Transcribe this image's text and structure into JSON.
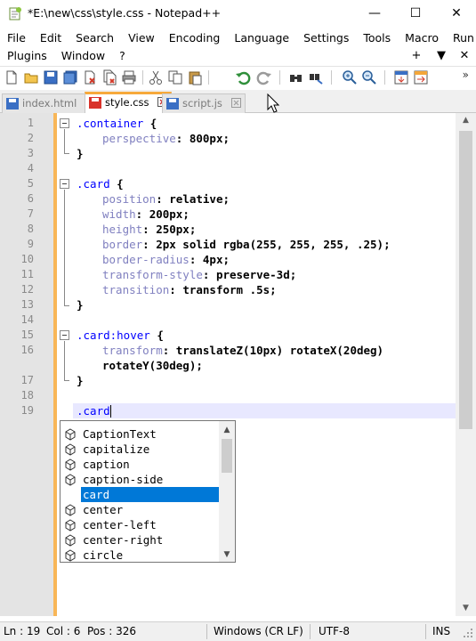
{
  "window": {
    "title": "*E:\\new\\css\\style.css - Notepad++",
    "minimize_glyph": "—",
    "maximize_glyph": "☐",
    "close_glyph": "✕"
  },
  "menu": {
    "row1": [
      "File",
      "Edit",
      "Search",
      "View",
      "Encoding",
      "Language",
      "Settings",
      "Tools",
      "Macro",
      "Run"
    ],
    "row2": [
      "Plugins",
      "Window",
      "?"
    ],
    "doc_controls": [
      "+",
      "▼",
      "✕"
    ]
  },
  "toolbar": {
    "icons": [
      "new-file-icon",
      "open-file-icon",
      "save-icon",
      "save-all-icon",
      "close-icon",
      "close-all-icon",
      "print-icon",
      "cut-icon",
      "copy-icon",
      "paste-icon",
      "undo-icon",
      "redo-icon",
      "find-icon",
      "replace-icon",
      "zoom-in-icon",
      "zoom-out-icon",
      "sync-vertical-icon",
      "sync-horizontal-icon"
    ],
    "more_glyph": "»"
  },
  "tabs": [
    {
      "label": "index.html",
      "active": false
    },
    {
      "label": "style.css",
      "active": true
    },
    {
      "label": "script.js",
      "active": false
    }
  ],
  "editor": {
    "line_numbers": [
      "1",
      "2",
      "3",
      "4",
      "5",
      "6",
      "7",
      "8",
      "9",
      "10",
      "11",
      "12",
      "13",
      "14",
      "15",
      "16",
      "",
      "17",
      "18",
      "19"
    ],
    "code": {
      "l1_sel": ".container",
      "l1_op": " {",
      "l2_prop": "perspective",
      "l2_val": ": 800px;",
      "l3": "}",
      "l5_sel": ".card",
      "l5_op": " {",
      "l6_prop": "position",
      "l6_val": ": relative;",
      "l7_prop": "width",
      "l7_val": ": 200px;",
      "l8_prop": "height",
      "l8_val": ": 250px;",
      "l9_prop": "border",
      "l9_val": ": 2px solid rgba(255, 255, 255, .25);",
      "l10_prop": "border-radius",
      "l10_val": ": 4px;",
      "l11_prop": "transform-style",
      "l11_val": ": preserve-3d;",
      "l12_prop": "transition",
      "l12_val": ": transform .5s;",
      "l13": "}",
      "l15_sel": ".card:hover",
      "l15_op": " {",
      "l16_prop": "transform",
      "l16_val": ": translateZ(10px) rotateX(20deg)",
      "l16b_val": "rotateY(30deg);",
      "l17": "}",
      "l19_sel": ".card"
    }
  },
  "autocomplete": {
    "items": [
      "CaptionText",
      "capitalize",
      "caption",
      "caption-side",
      "card",
      "center",
      "center-left",
      "center-right",
      "circle"
    ],
    "selected": "card"
  },
  "statusbar": {
    "ln": "Ln : 19",
    "col": "Col : 6",
    "pos": "Pos : 326",
    "eol": "Windows (CR LF)",
    "encoding": "UTF-8",
    "mode": "INS"
  }
}
